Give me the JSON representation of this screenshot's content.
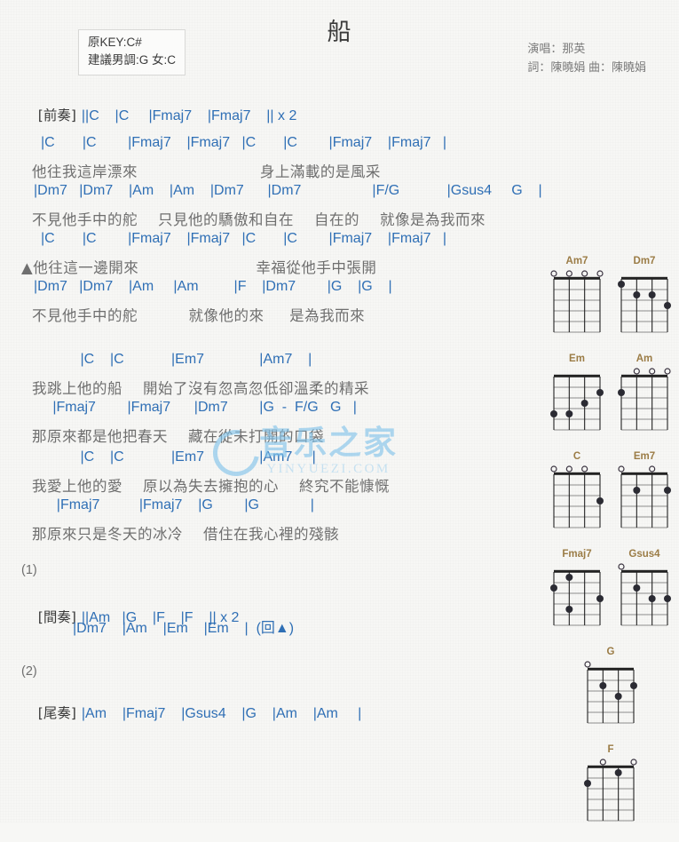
{
  "header": {
    "title": "船",
    "key_box": [
      "原KEY:C#",
      "建議男調:G 女:C"
    ],
    "credits": [
      "演唱：那英",
      "詞：陳曉娟  曲：陳曉娟"
    ]
  },
  "sections": {
    "intro_label": "[前奏]",
    "intro_chords": "||C    |C     |Fmaj7    |Fmaj7    || x 2",
    "interlude_num": "(1)",
    "interlude_label": "[間奏]",
    "interlude_chords_1": "||Am   |G    |F    |F    || x 2",
    "interlude_chords_2": "|Dm7    |Am    |Em    |Em    |  (回▲)",
    "outro_num": "(2)",
    "outro_label": "[尾奏]",
    "outro_chords": "|Am    |Fmaj7    |Gsus4    |G    |Am    |Am     |"
  },
  "body": [
    {
      "chords": "|C       |C        |Fmaj7    |Fmaj7   |C       |C        |Fmaj7    |Fmaj7   |",
      "lyric": "他往我這岸漂來                        身上滿載的是風采"
    },
    {
      "chords": "|Dm7   |Dm7    |Am    |Am    |Dm7      |Dm7                  |F/G            |Gsus4     G    |",
      "lyric": "不見他手中的舵    只見他的驕傲和自在    自在的    就像是為我而來"
    },
    {
      "chords": "|C       |C        |Fmaj7    |Fmaj7   |C       |C        |Fmaj7    |Fmaj7   |",
      "lyric": "▲他往這一邊開來                       幸福從他手中張開"
    },
    {
      "chords": "|Dm7   |Dm7    |Am     |Am         |F    |Dm7        |G    |G    |",
      "lyric": "不見他手中的舵          就像他的來     是為我而來"
    },
    {
      "chords": "          |C    |C            |Em7              |Am7    |",
      "lyric": "我跳上他的船    開始了沒有忽高忽低卻溫柔的精采"
    },
    {
      "chords": "   |Fmaj7        |Fmaj7      |Dm7        |G  -  F/G   G   |",
      "lyric": "那原來都是他把春天    藏在從未打開的口袋"
    },
    {
      "chords": "          |C    |C            |Em7              |Am7     |",
      "lyric": "我愛上他的愛    原以為失去擁抱的心    終究不能慷慨"
    },
    {
      "chords": "    |Fmaj7          |Fmaj7    |G        |G             |",
      "lyric": "那原來只是冬天的冰冷    借住在我心裡的殘骸"
    }
  ],
  "watermark": {
    "main": "音乐之家",
    "sub": "YINYUEZI.COM"
  },
  "diagrams": [
    {
      "name": "Am7",
      "open": [
        1,
        1,
        1,
        1
      ],
      "dots": []
    },
    {
      "name": "Dm7",
      "open": [
        0,
        0,
        0,
        0
      ],
      "dots": [
        [
          4,
          1
        ],
        [
          3,
          2
        ],
        [
          2,
          2
        ],
        [
          1,
          3
        ]
      ]
    },
    {
      "name": "Em",
      "open": [
        0,
        0,
        0,
        0
      ],
      "dots": [
        [
          4,
          4
        ],
        [
          3,
          4
        ],
        [
          2,
          3
        ],
        [
          1,
          2
        ]
      ]
    },
    {
      "name": "Am",
      "open": [
        0,
        1,
        1,
        1
      ],
      "dots": [
        [
          4,
          2
        ]
      ]
    },
    {
      "name": "C",
      "open": [
        1,
        1,
        1,
        0
      ],
      "dots": [
        [
          1,
          3
        ]
      ]
    },
    {
      "name": "Em7",
      "open": [
        1,
        0,
        1,
        0
      ],
      "dots": [
        [
          3,
          2
        ],
        [
          1,
          2
        ]
      ]
    },
    {
      "name": "Fmaj7",
      "open": [
        0,
        0,
        0,
        0
      ],
      "dots": [
        [
          4,
          2
        ],
        [
          3,
          1
        ],
        [
          3,
          4
        ],
        [
          1,
          3
        ]
      ]
    },
    {
      "name": "Gsus4",
      "open": [
        1,
        0,
        0,
        0
      ],
      "dots": [
        [
          3,
          2
        ],
        [
          2,
          3
        ],
        [
          1,
          3
        ]
      ]
    },
    {
      "name": "G",
      "open": [
        1,
        0,
        0,
        0
      ],
      "dots": [
        [
          3,
          2
        ],
        [
          2,
          3
        ],
        [
          1,
          2
        ]
      ]
    },
    {
      "name": "F",
      "open": [
        0,
        1,
        0,
        1
      ],
      "dots": [
        [
          4,
          2
        ],
        [
          2,
          1
        ]
      ]
    }
  ],
  "colors": {
    "chord": "#2f6fb5",
    "lyric": "#6f6f6f",
    "diagram_name": "#9b7c46",
    "watermark": "#7fc2ea",
    "paper": "#f7f7f5"
  }
}
